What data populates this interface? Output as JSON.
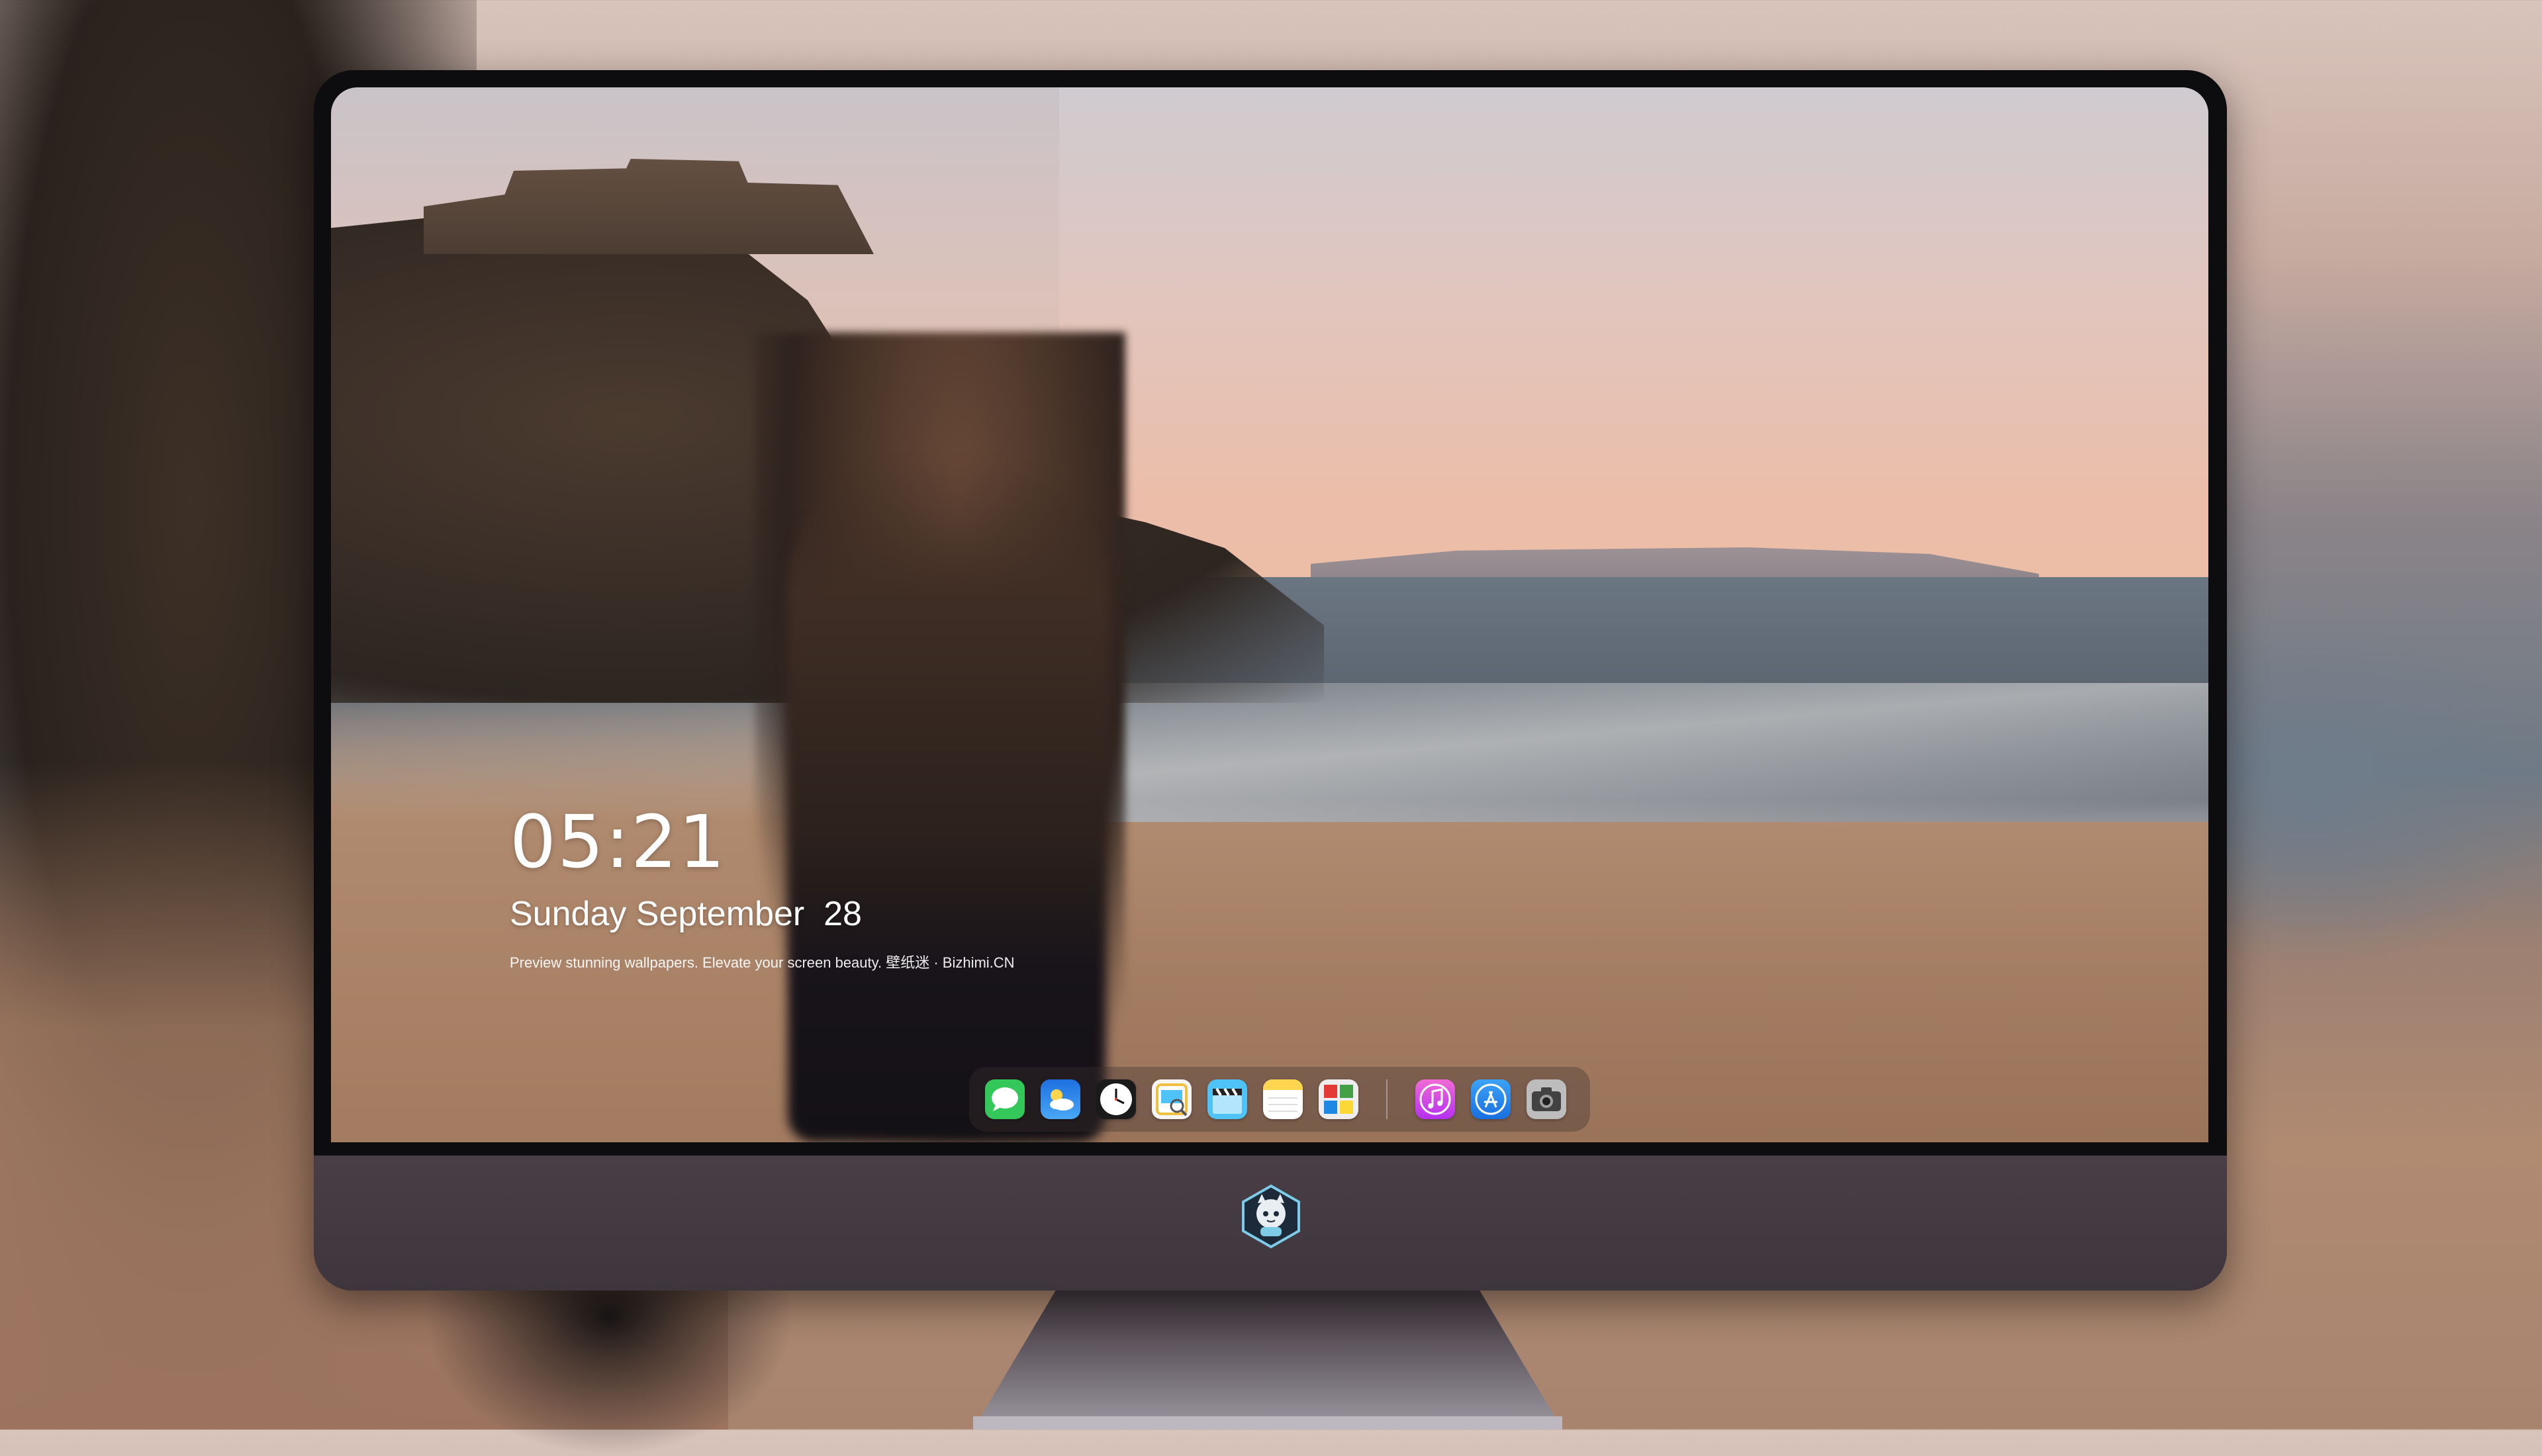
{
  "lock_screen": {
    "time": "05:21",
    "date": "Sunday September  28",
    "caption": "Preview stunning wallpapers. Elevate your screen beauty. 壁纸迷 · Bizhimi.CN"
  },
  "dock": {
    "apps": [
      {
        "name": "messages",
        "icon": "messages-icon",
        "color": "#34c759"
      },
      {
        "name": "weather",
        "icon": "weather-icon",
        "color": "#1e88e5"
      },
      {
        "name": "clock",
        "icon": "clock-icon",
        "color": "#ffffff"
      },
      {
        "name": "preview",
        "icon": "preview-icon",
        "color": "#f0c040"
      },
      {
        "name": "clips",
        "icon": "clapperboard-icon",
        "color": "#4fc3f7"
      },
      {
        "name": "notes",
        "icon": "notes-icon",
        "color": "#ffd54f"
      },
      {
        "name": "photo-booth",
        "icon": "photo-grid-icon",
        "color": "#e0e0e0"
      },
      {
        "name": "itunes",
        "icon": "music-note-icon",
        "color": "#e040fb"
      },
      {
        "name": "app-store",
        "icon": "app-store-icon",
        "color": "#2196f3"
      },
      {
        "name": "camera",
        "icon": "camera-icon",
        "color": "#9e9e9e"
      }
    ]
  },
  "brand": {
    "icon": "mascot-logo-icon",
    "color": "#7ecbe8"
  }
}
